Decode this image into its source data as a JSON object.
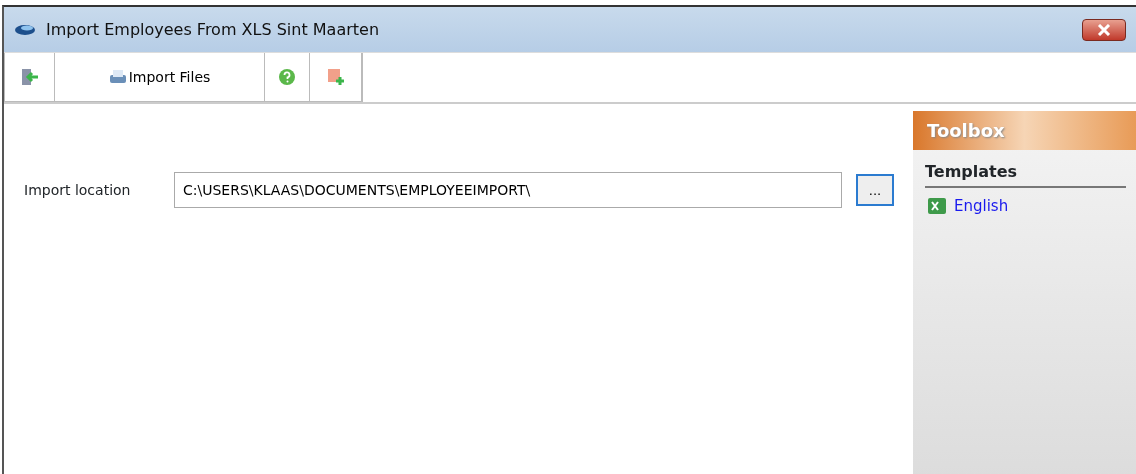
{
  "window": {
    "title": "Import Employees From XLS Sint Maarten"
  },
  "toolbar": [
    {
      "kind": "exit"
    },
    {
      "kind": "import",
      "label": "Import Files"
    },
    {
      "kind": "help"
    },
    {
      "kind": "add"
    }
  ],
  "form": {
    "label": "Import location",
    "value": "C:\\USERS\\KLAAS\\DOCUMENTS\\EMPLOYEEIMPORT\\",
    "browse_label": "..."
  },
  "toolbox": {
    "title": "Toolbox",
    "section": "Templates",
    "templates": [
      {
        "label": "English"
      }
    ]
  }
}
